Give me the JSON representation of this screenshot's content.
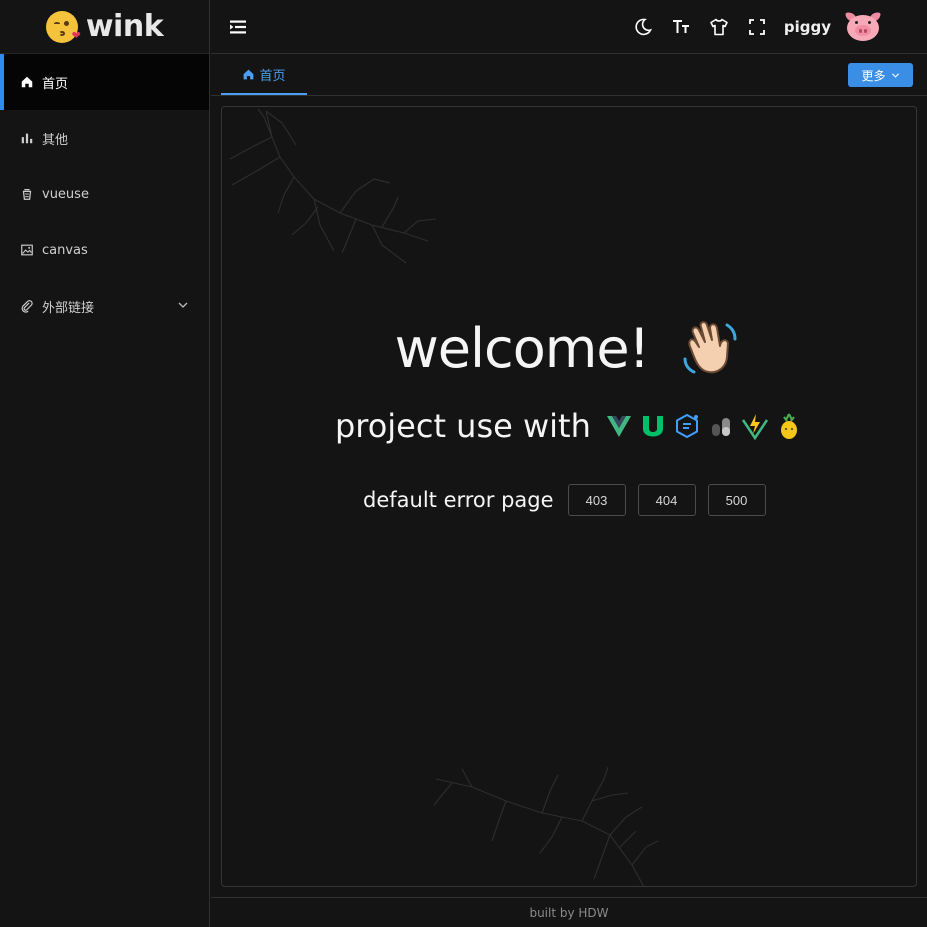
{
  "app": {
    "logo_text": "wink",
    "logo_icon": "kissing-face-emoji"
  },
  "sidebar": {
    "items": [
      {
        "label": "首页",
        "icon": "home-icon",
        "active": true
      },
      {
        "label": "其他",
        "icon": "bar-chart-icon"
      },
      {
        "label": "vueuse",
        "icon": "cup-icon"
      },
      {
        "label": "canvas",
        "icon": "image-icon"
      },
      {
        "label": "外部链接",
        "icon": "paperclip-icon",
        "expandable": true
      }
    ]
  },
  "header": {
    "menu_toggle_icon": "menu-fold-icon",
    "tools": [
      "moon-icon",
      "font-size-icon",
      "tshirt-icon",
      "fullscreen-icon"
    ],
    "username": "piggy",
    "avatar": "pig-emoji"
  },
  "tabs": {
    "items": [
      {
        "label": "首页",
        "icon": "home-icon"
      }
    ],
    "more_label": "更多"
  },
  "main": {
    "welcome": "welcome!",
    "welcome_emoji": "waving-hand-emoji",
    "project_text": "project use with",
    "project_icons": [
      "vue-icon",
      "nuxt-ui-icon",
      "element-icon",
      "pinia-icon",
      "vite-icon",
      "pineapple-icon"
    ],
    "error_label": "default error page",
    "error_buttons": [
      "403",
      "404",
      "500"
    ]
  },
  "footer": {
    "text": "built by HDW"
  },
  "colors": {
    "accent": "#3a8ee6",
    "tab_active": "#4b9ef5",
    "background": "#141414",
    "border": "#303030"
  }
}
